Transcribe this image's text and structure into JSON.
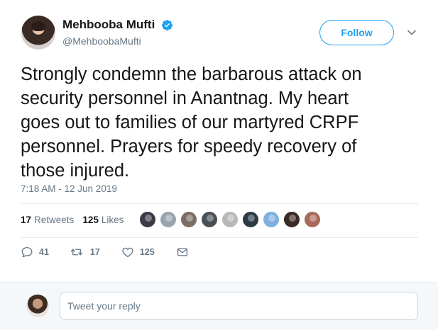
{
  "author": {
    "display_name": "Mehbooba Mufti",
    "handle": "@MehboobaMufti",
    "verified": true
  },
  "follow_button": {
    "label": "Follow"
  },
  "tweet": {
    "text": "Strongly condemn the barbarous attack on\nsecurity personnel in Anantnag. My heart\ngoes out to  families of our martyred CRPF\npersonnel. Prayers for speedy recovery of\nthose injured.",
    "timestamp": "7:18 AM - 12 Jun 2019"
  },
  "stats": {
    "retweets_count": "17",
    "retweets_label": "Retweets",
    "likes_count": "125",
    "likes_label": "Likes"
  },
  "likers": [
    {
      "color": "#3d3a48"
    },
    {
      "color": "#9aa4ad"
    },
    {
      "color": "#7a6e66"
    },
    {
      "color": "#4a5058"
    },
    {
      "color": "#b8b8b8"
    },
    {
      "color": "#2c3a44"
    },
    {
      "color": "#7fb0e0"
    },
    {
      "color": "#3a2a26"
    },
    {
      "color": "#a86a58"
    }
  ],
  "actions": {
    "reply_count": "41",
    "retweet_count": "17",
    "like_count": "125"
  },
  "reply": {
    "placeholder": "Tweet your reply"
  },
  "colors": {
    "accent": "#1da1f2",
    "muted": "#657786",
    "text": "#14171a",
    "reply_bg": "#f5f8fa"
  },
  "icons": {
    "verified": "verified-badge-icon",
    "caret": "chevron-down-icon",
    "reply": "reply-bubble-icon",
    "retweet": "retweet-icon",
    "like": "heart-icon",
    "dm": "envelope-icon"
  }
}
